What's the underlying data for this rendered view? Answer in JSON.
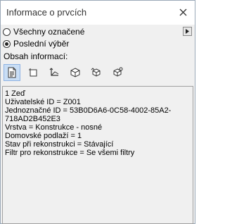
{
  "window": {
    "title": "Informace o prvcích"
  },
  "selection": {
    "options": [
      {
        "label": "Všechny označené",
        "checked": false
      },
      {
        "label": "Poslední výběr",
        "checked": true
      }
    ]
  },
  "content_section": {
    "label": "Obsah informací:",
    "icons": [
      {
        "name": "info-document-icon",
        "active": true
      },
      {
        "name": "element-icon",
        "active": false
      },
      {
        "name": "axes-icon",
        "active": false
      },
      {
        "name": "cube-icon",
        "active": false
      },
      {
        "name": "cube-rotate-icon",
        "active": false
      },
      {
        "name": "cube-link-icon",
        "active": false
      }
    ]
  },
  "info": {
    "lines": [
      "1 Zeď",
      "Uživatelské ID = Z001",
      "Jednoznačné ID = 53B0D6A6-0C58-4002-85A2-",
      "718AD2B452E3",
      "Vrstva = Konstrukce - nosné",
      "Domovské podlaží = 1",
      "Stav při rekonstrukci = Stávající",
      "Filtr pro rekonstrukce = Se všemi filtry"
    ]
  }
}
